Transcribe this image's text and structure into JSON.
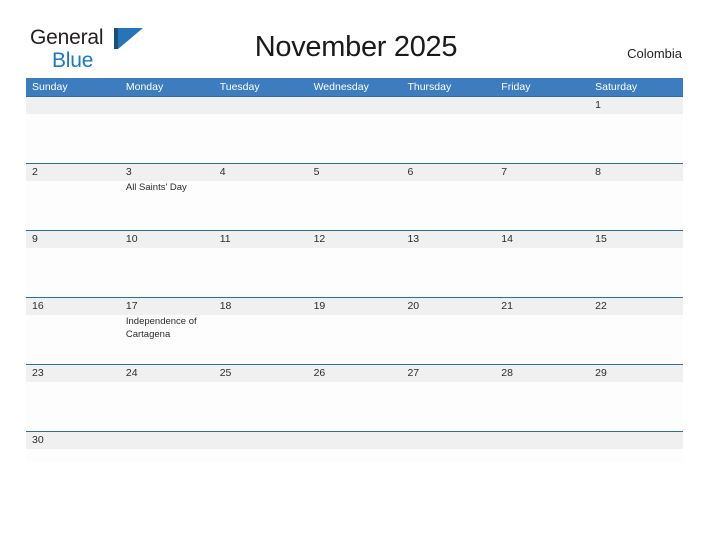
{
  "brand": {
    "line1": "General",
    "line2": "Blue",
    "flag_icon": "blue-flag-triangle",
    "text_color": "#231f20",
    "accent_color": "#1b7ac4"
  },
  "header": {
    "title": "November 2025",
    "country": "Colombia"
  },
  "theme": {
    "header_bar_color": "#3c7cbf",
    "row_divider_color": "#2e6da4",
    "number_band_color": "#f0f0f0",
    "page_background": "#ffffff"
  },
  "calendar": {
    "month": "November",
    "year": "2025",
    "weekday_headers": [
      "Sunday",
      "Monday",
      "Tuesday",
      "Wednesday",
      "Thursday",
      "Friday",
      "Saturday"
    ],
    "weeks": [
      {
        "days": [
          {
            "number": "",
            "event": ""
          },
          {
            "number": "",
            "event": ""
          },
          {
            "number": "",
            "event": ""
          },
          {
            "number": "",
            "event": ""
          },
          {
            "number": "",
            "event": ""
          },
          {
            "number": "",
            "event": ""
          },
          {
            "number": "1",
            "event": ""
          }
        ]
      },
      {
        "days": [
          {
            "number": "2",
            "event": ""
          },
          {
            "number": "3",
            "event": "All Saints' Day"
          },
          {
            "number": "4",
            "event": ""
          },
          {
            "number": "5",
            "event": ""
          },
          {
            "number": "6",
            "event": ""
          },
          {
            "number": "7",
            "event": ""
          },
          {
            "number": "8",
            "event": ""
          }
        ]
      },
      {
        "days": [
          {
            "number": "9",
            "event": ""
          },
          {
            "number": "10",
            "event": ""
          },
          {
            "number": "11",
            "event": ""
          },
          {
            "number": "12",
            "event": ""
          },
          {
            "number": "13",
            "event": ""
          },
          {
            "number": "14",
            "event": ""
          },
          {
            "number": "15",
            "event": ""
          }
        ]
      },
      {
        "days": [
          {
            "number": "16",
            "event": ""
          },
          {
            "number": "17",
            "event": "Independence of Cartagena"
          },
          {
            "number": "18",
            "event": ""
          },
          {
            "number": "19",
            "event": ""
          },
          {
            "number": "20",
            "event": ""
          },
          {
            "number": "21",
            "event": ""
          },
          {
            "number": "22",
            "event": ""
          }
        ]
      },
      {
        "days": [
          {
            "number": "23",
            "event": ""
          },
          {
            "number": "24",
            "event": ""
          },
          {
            "number": "25",
            "event": ""
          },
          {
            "number": "26",
            "event": ""
          },
          {
            "number": "27",
            "event": ""
          },
          {
            "number": "28",
            "event": ""
          },
          {
            "number": "29",
            "event": ""
          }
        ]
      },
      {
        "days": [
          {
            "number": "30",
            "event": ""
          },
          {
            "number": "",
            "event": ""
          },
          {
            "number": "",
            "event": ""
          },
          {
            "number": "",
            "event": ""
          },
          {
            "number": "",
            "event": ""
          },
          {
            "number": "",
            "event": ""
          },
          {
            "number": "",
            "event": ""
          }
        ]
      }
    ]
  }
}
